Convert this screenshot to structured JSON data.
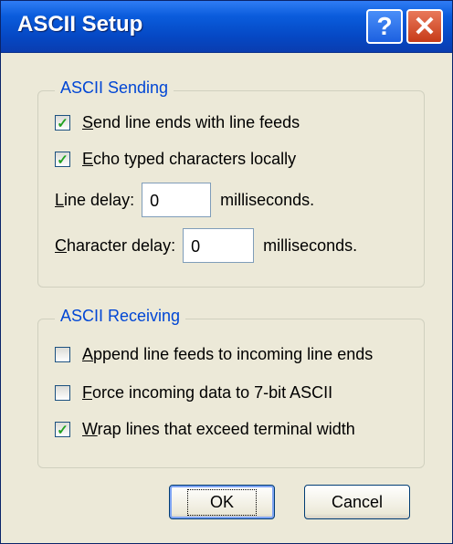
{
  "window": {
    "title": "ASCII Setup",
    "help_label": "?",
    "close_label": "✕"
  },
  "sending": {
    "legend": "ASCII Sending",
    "send_line_ends": {
      "accel": "S",
      "rest": "end line ends with line feeds",
      "checked": true
    },
    "echo_typed": {
      "accel": "E",
      "rest": "cho typed characters locally",
      "checked": true
    },
    "line_delay": {
      "accel": "L",
      "rest": "ine delay:",
      "value": "0",
      "unit": "milliseconds."
    },
    "char_delay": {
      "accel": "C",
      "rest": "haracter delay:",
      "value": "0",
      "unit": "milliseconds."
    }
  },
  "receiving": {
    "legend": "ASCII Receiving",
    "append_line_feeds": {
      "accel": "A",
      "rest": "ppend line feeds to incoming line ends",
      "checked": false
    },
    "force_7bit": {
      "accel": "F",
      "rest": "orce incoming data to 7-bit ASCII",
      "checked": false
    },
    "wrap_lines": {
      "accel": "W",
      "rest": "rap lines that exceed terminal width",
      "checked": true
    }
  },
  "buttons": {
    "ok": "OK",
    "cancel": "Cancel"
  },
  "icons": {
    "help": "help-icon",
    "close": "close-icon",
    "check": "checkmark-icon"
  },
  "colors": {
    "titlebar": "#0548c4",
    "dialog_bg": "#ece9d8",
    "legend_text": "#0046d5",
    "check": "#21a121"
  }
}
